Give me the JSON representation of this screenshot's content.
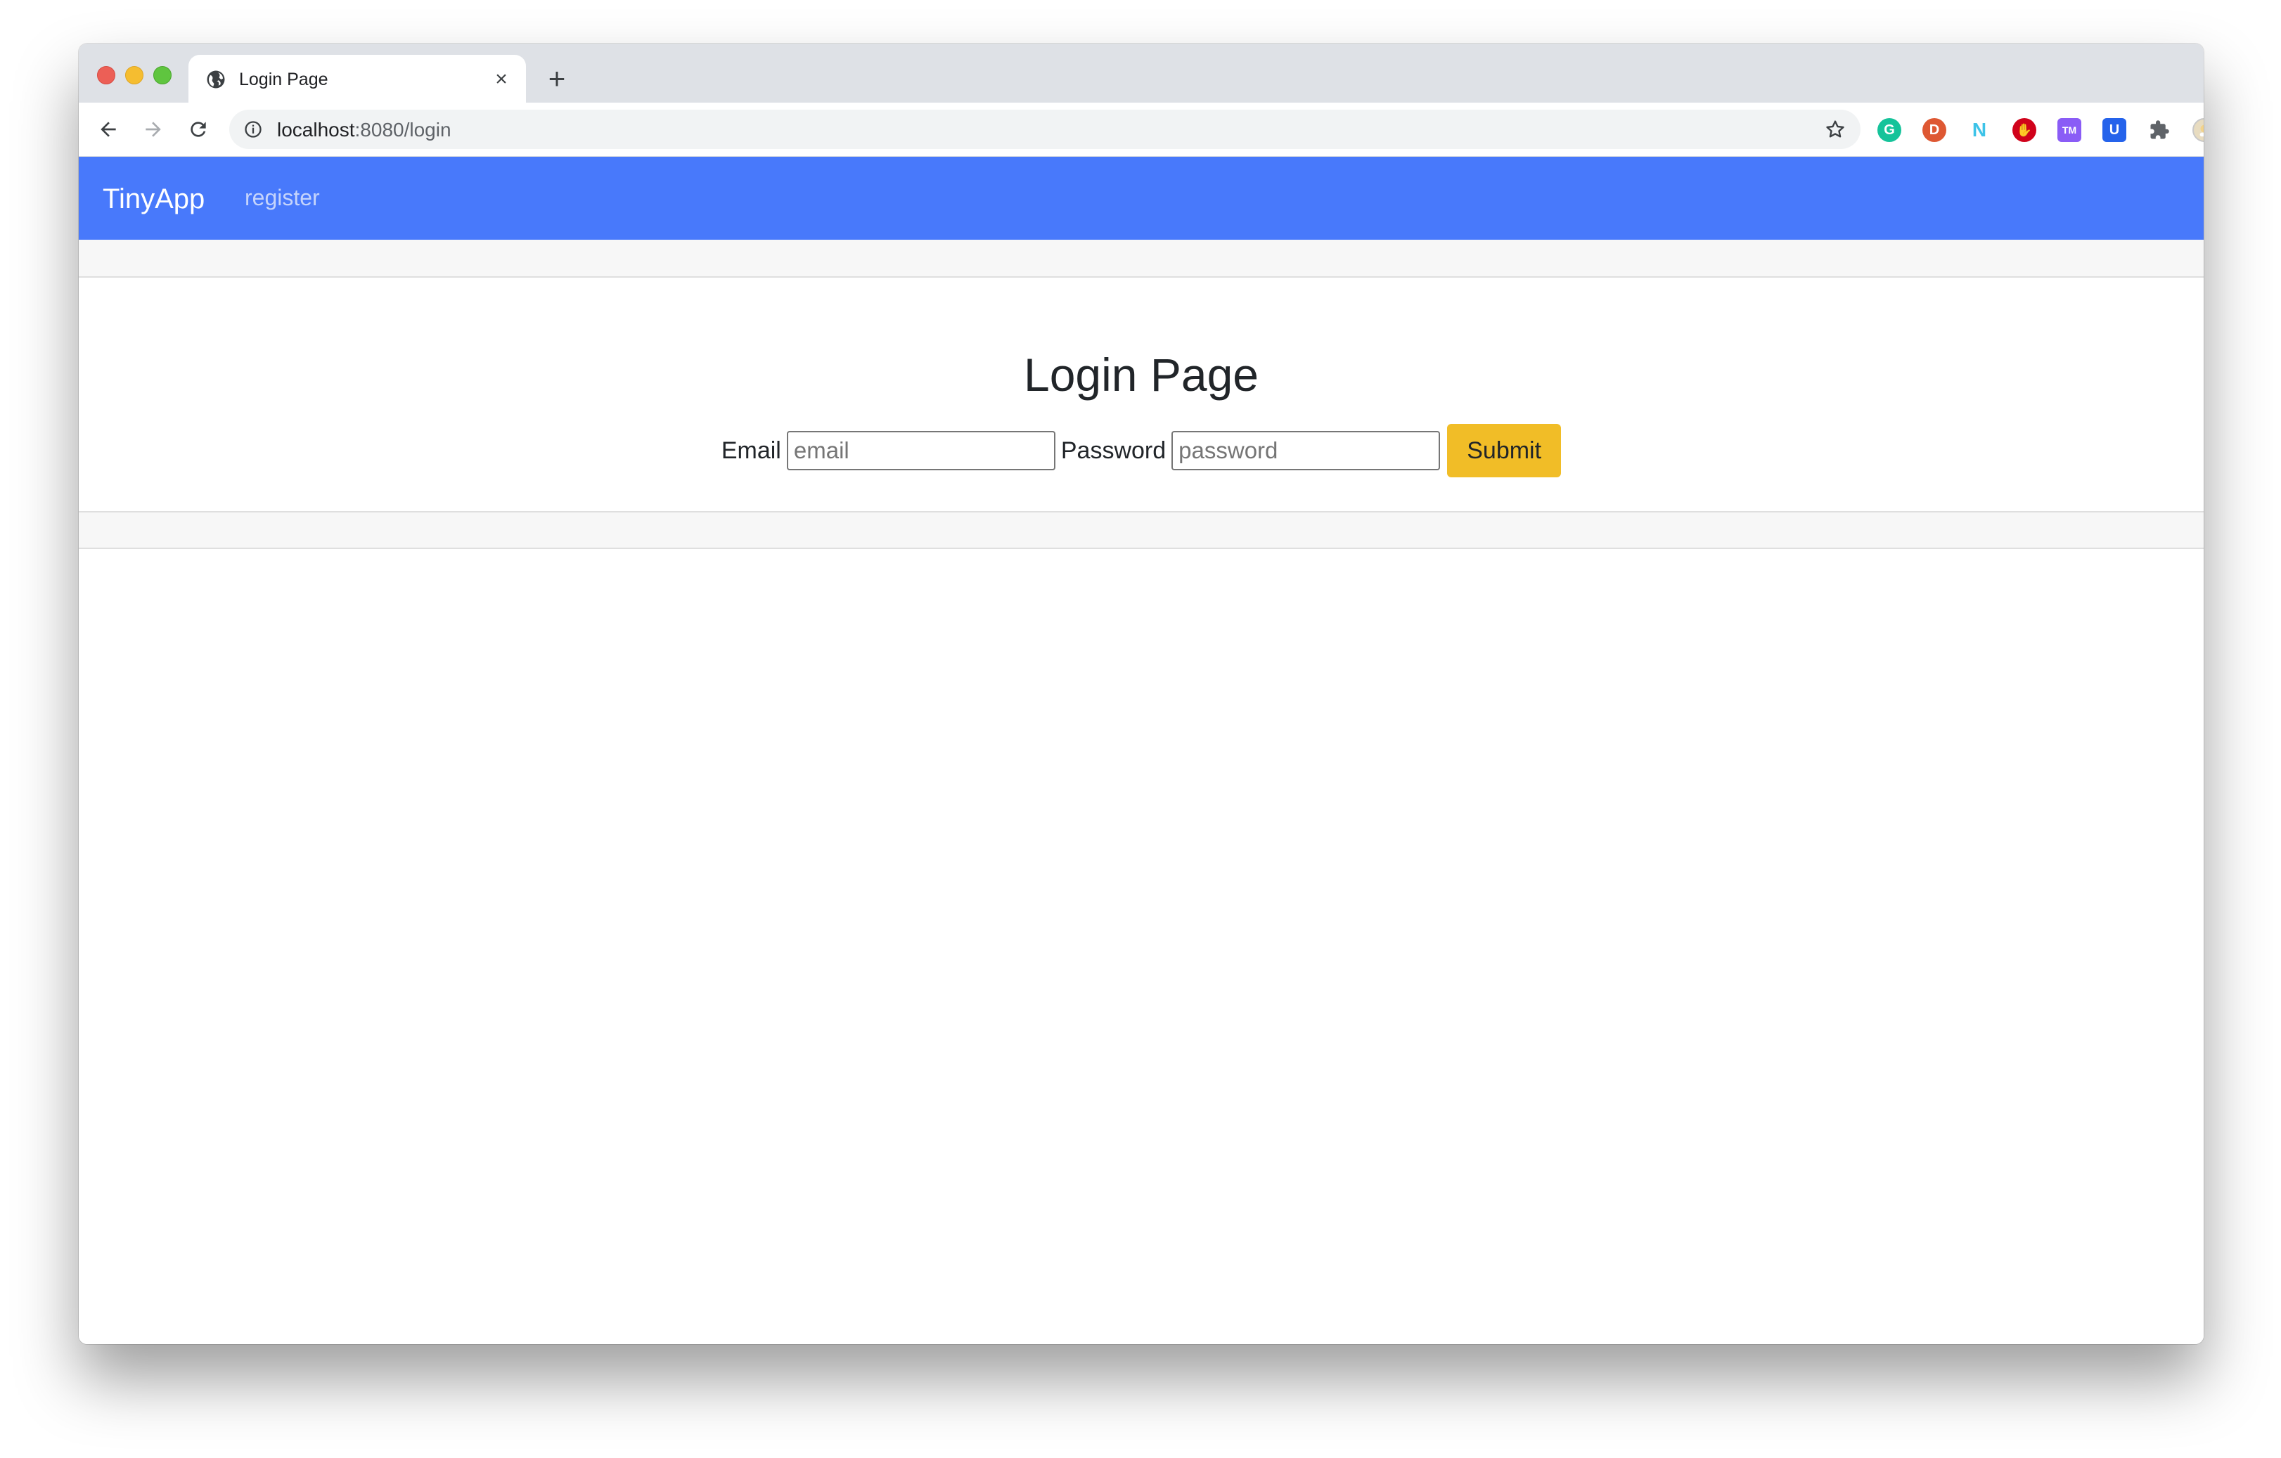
{
  "browser": {
    "tab_title": "Login Page",
    "new_tab_symbol": "+",
    "close_symbol": "×",
    "url_host": "localhost",
    "url_path": ":8080/login",
    "extensions": [
      {
        "name": "grammarly-icon",
        "color": "#15c39a",
        "glyph": "G"
      },
      {
        "name": "duckduckgo-icon",
        "color": "#de5833",
        "glyph": "D"
      },
      {
        "name": "n-extension-icon",
        "color": "#3dc3e8",
        "glyph": "N"
      },
      {
        "name": "adblock-icon",
        "color": "#d0021b",
        "glyph": "✋"
      },
      {
        "name": "purple-puzzle-icon",
        "color": "#8a5cf6",
        "glyph": "TM"
      },
      {
        "name": "shield-extension-icon",
        "color": "#2563eb",
        "glyph": "U"
      },
      {
        "name": "extensions-puzzle-icon",
        "color": "#5f6368",
        "glyph": ""
      },
      {
        "name": "profile-avatar-icon",
        "color": "#e8dcc0",
        "glyph": ""
      }
    ]
  },
  "app": {
    "brand": "TinyApp",
    "nav_link": "register",
    "accent_color": "#4879fb"
  },
  "login": {
    "title": "Login Page",
    "email_label": "Email",
    "email_placeholder": "email",
    "password_label": "Password",
    "password_placeholder": "password",
    "submit_label": "Submit",
    "submit_color": "#f1bd27"
  }
}
